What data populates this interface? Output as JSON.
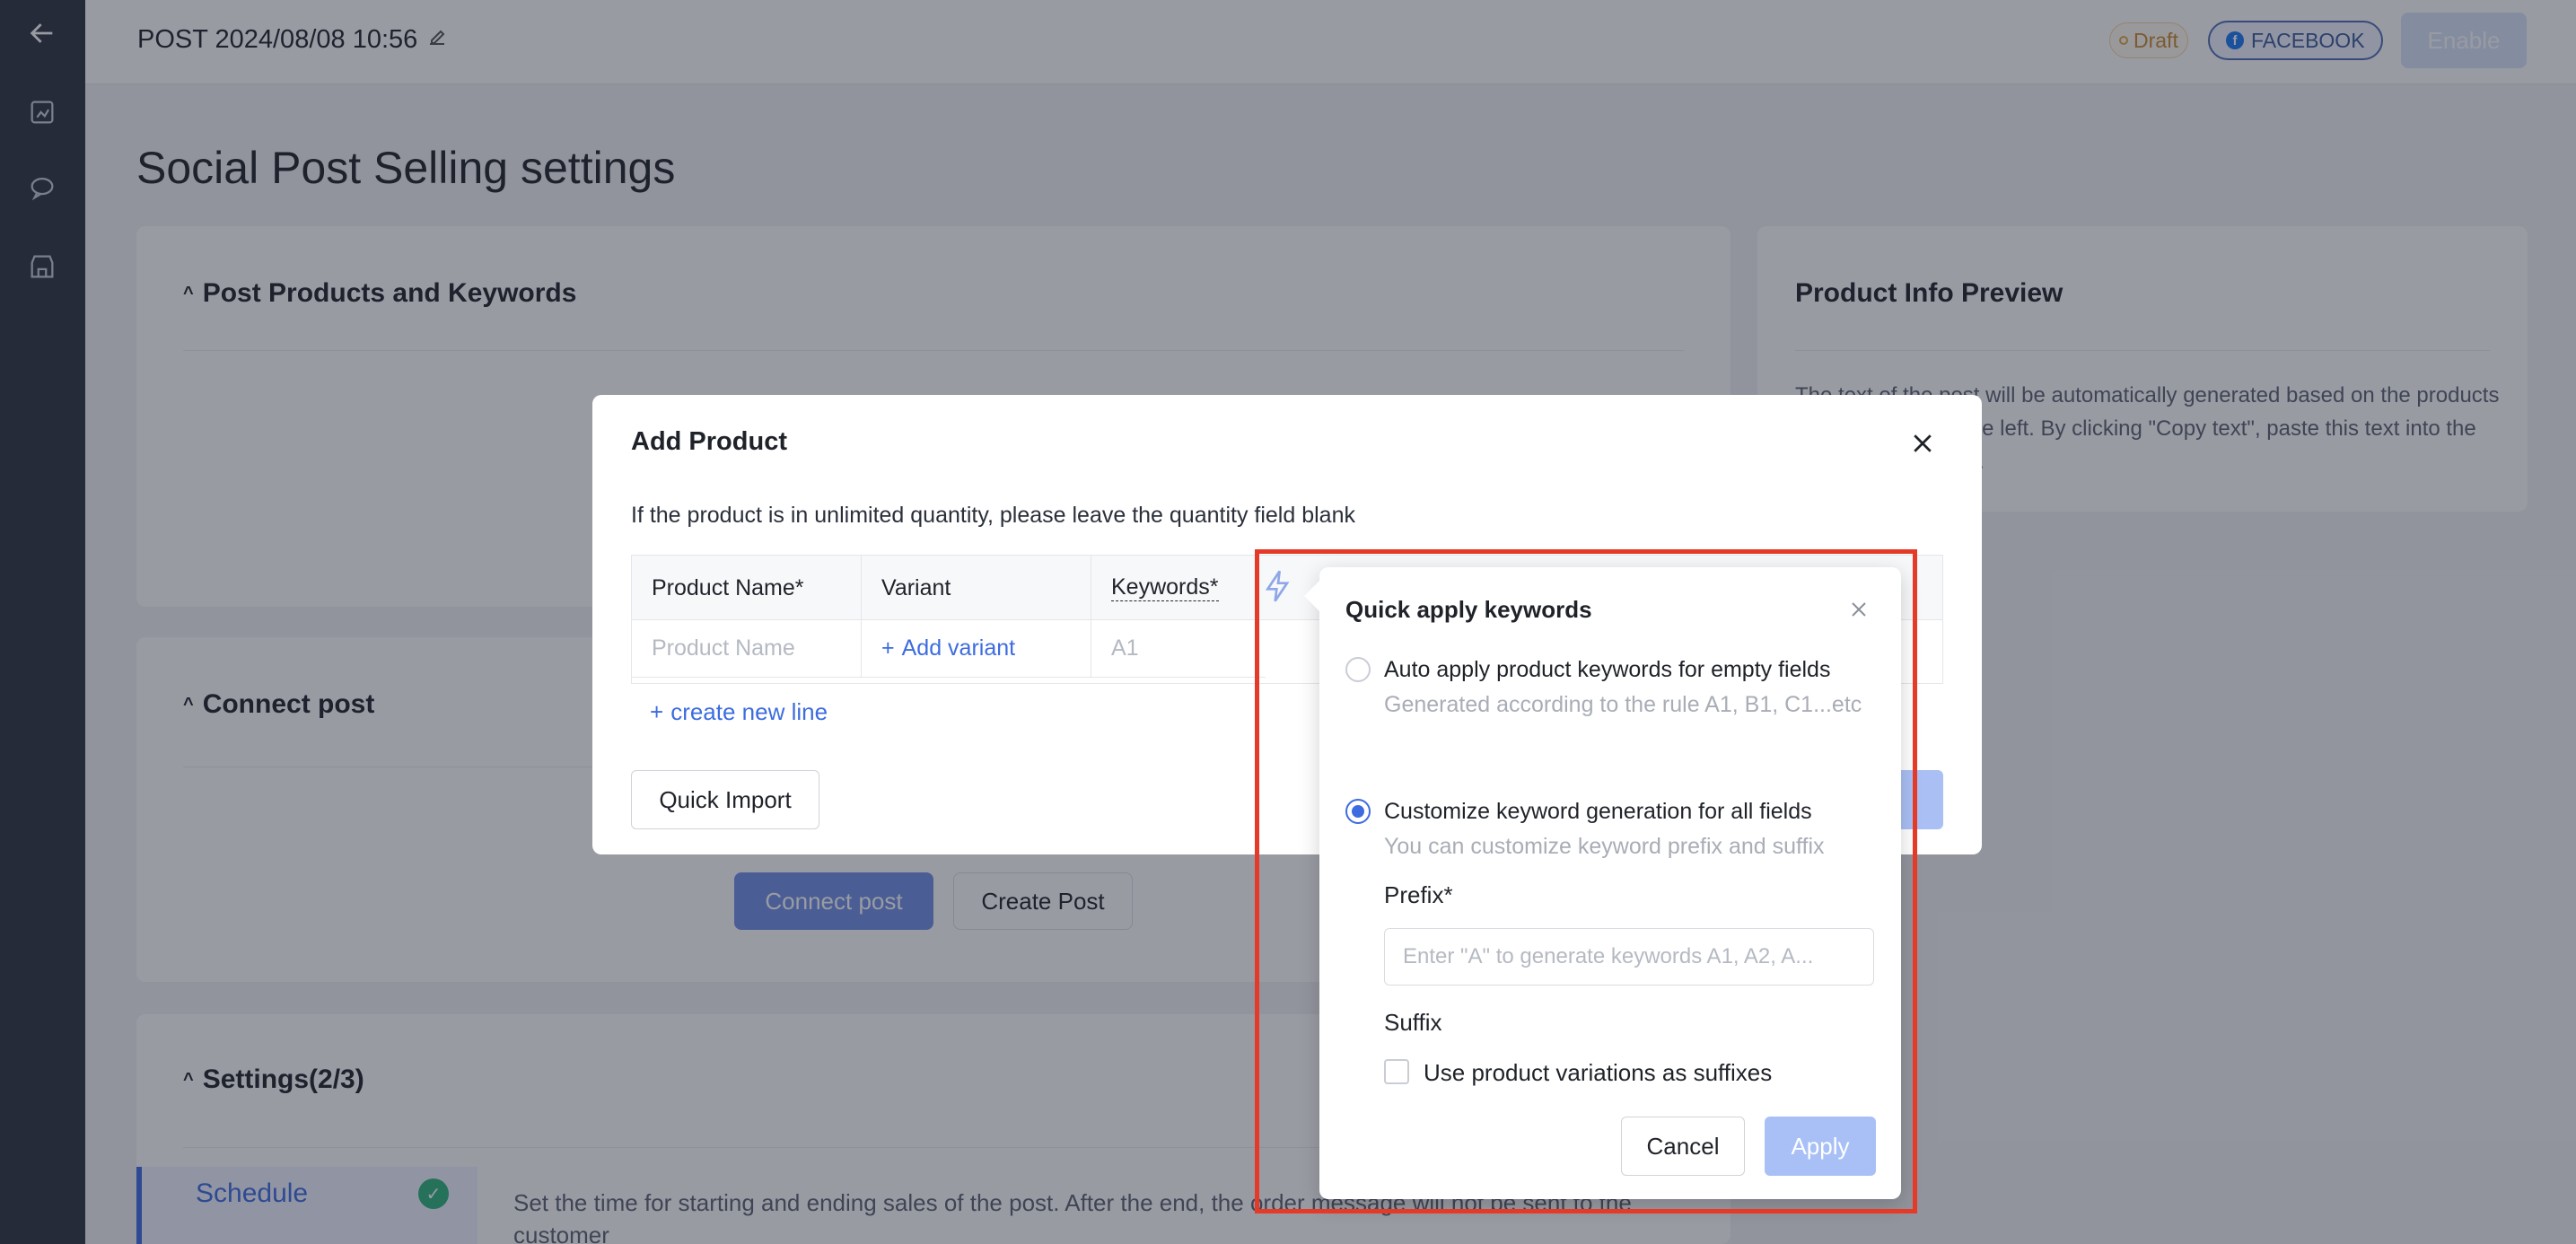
{
  "rail": {
    "icons": [
      "back-arrow-icon",
      "posts-icon",
      "chat-icon",
      "store-icon"
    ]
  },
  "header": {
    "title": "POST 2024/08/08 10:56",
    "status": "Draft",
    "platform": "FACEBOOK",
    "enable_label": "Enable"
  },
  "page_title": "Social Post Selling settings",
  "sections": {
    "products": "Post Products and Keywords",
    "connect": "Connect post",
    "settings": "Settings(2/3)",
    "preview_title": "Product Info Preview",
    "preview_text": "The text of the post will be automatically generated based on the products and keywords on the left. By clicking \"Copy text\", paste this text into the corresponding post.",
    "connect_button": "Connect post",
    "create_post_button": "Create Post",
    "schedule_tab": "Schedule",
    "schedule_desc": "Set the time for starting and ending sales of the post. After the end, the order message will not be sent to the customer"
  },
  "modal": {
    "title": "Add Product",
    "hint": "If the product is in unlimited quantity, please leave the quantity field blank",
    "columns": [
      "Product Name*",
      "Variant",
      "Keywords*"
    ],
    "row": {
      "name_placeholder": "Product Name",
      "add_variant": "Add variant",
      "keyword_placeholder": "A1"
    },
    "create_line": "create new line",
    "quick_import": "Quick Import"
  },
  "popover": {
    "title": "Quick apply keywords",
    "option1_label": "Auto apply product keywords for empty fields",
    "option1_desc": "Generated according to the rule A1, B1, C1...etc",
    "option2_label": "Customize keyword generation for all fields",
    "option2_desc": "You can customize keyword prefix and suffix",
    "selected_option": 2,
    "prefix_label": "Prefix*",
    "prefix_placeholder": "Enter \"A\" to generate keywords A1, A2, A...",
    "suffix_label": "Suffix",
    "suffix_checkbox": "Use product variations as suffixes",
    "cancel": "Cancel",
    "apply": "Apply"
  },
  "colors": {
    "accent": "#3d6ce0",
    "highlight": "#e53a27",
    "rail": "#2f3441"
  }
}
